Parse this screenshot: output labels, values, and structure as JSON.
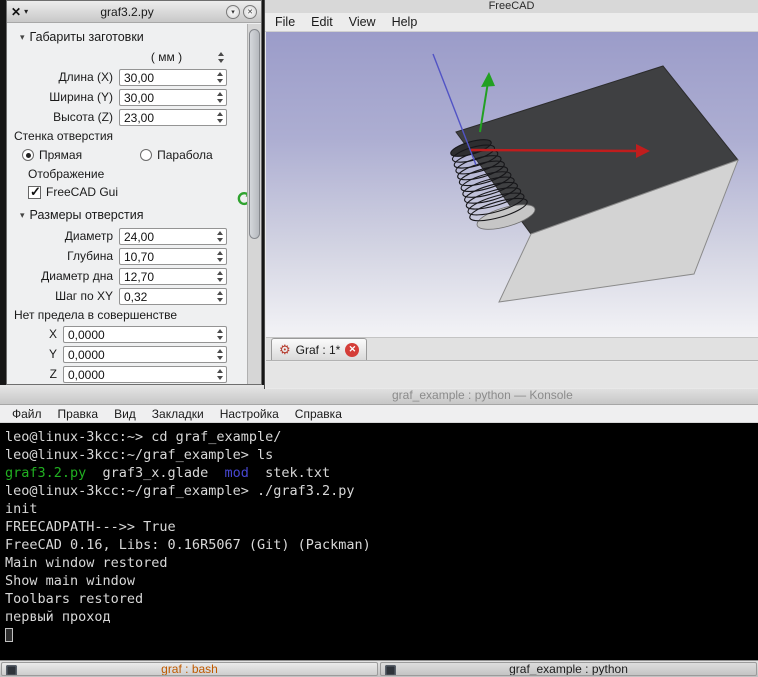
{
  "dialog": {
    "title": "graf3.2.py",
    "sections": {
      "dims_header": "Габариты заготовки",
      "units_label": "( мм )",
      "dims_rows": [
        {
          "name": "length-x",
          "label": "Длина (X)",
          "value": "30,00"
        },
        {
          "name": "width-y",
          "label": "Ширина (Y)",
          "value": "30,00"
        },
        {
          "name": "height-z",
          "label": "Высота (Z)",
          "value": "23,00"
        }
      ],
      "wall_header": "Стенка отверстия",
      "wall_options": [
        {
          "name": "straight",
          "label": "Прямая",
          "selected": true
        },
        {
          "name": "parabola",
          "label": "Парабола",
          "selected": false
        }
      ],
      "display_header": "Отображение",
      "freecad_gui_checkbox": {
        "label": "FreeCAD Gui",
        "checked": true
      },
      "hole_header": "Размеры отверстия",
      "hole_rows": [
        {
          "name": "diameter",
          "label": "Диаметр",
          "value": "24,00"
        },
        {
          "name": "depth",
          "label": "Глубина",
          "value": "10,70"
        },
        {
          "name": "bottom-diameter",
          "label": "Диаметр дна",
          "value": "12,70"
        },
        {
          "name": "xy-step",
          "label": "Шаг по XY",
          "value": "0,32"
        }
      ],
      "perfection_header": "Нет предела в совершенстве",
      "xyz_rows": [
        {
          "name": "offset-x",
          "label": "X",
          "value": "0,0000"
        },
        {
          "name": "offset-y",
          "label": "Y",
          "value": "0,0000"
        },
        {
          "name": "offset-z",
          "label": "Z",
          "value": "0,0000"
        }
      ]
    }
  },
  "freecad": {
    "title": "FreeCAD",
    "menu": [
      {
        "name": "file",
        "label": "File"
      },
      {
        "name": "edit",
        "label": "Edit"
      },
      {
        "name": "view",
        "label": "View"
      },
      {
        "name": "help",
        "label": "Help"
      }
    ],
    "tab": {
      "label": "Graf : 1*"
    }
  },
  "konsole": {
    "title": "graf_example : python — Konsole",
    "menu": [
      {
        "name": "file",
        "label": "Файл"
      },
      {
        "name": "edit",
        "label": "Правка"
      },
      {
        "name": "view",
        "label": "Вид"
      },
      {
        "name": "bookmarks",
        "label": "Закладки"
      },
      {
        "name": "settings",
        "label": "Настройка"
      },
      {
        "name": "help",
        "label": "Справка"
      }
    ],
    "colors": {
      "fg": "#d8d8d8",
      "bg": "#000000",
      "green": "#21b021",
      "blue": "#4747d1"
    },
    "lines": [
      [
        {
          "t": "leo@linux-3kcc:~> cd graf_example/"
        }
      ],
      [
        {
          "t": "leo@linux-3kcc:~/graf_example> ls"
        }
      ],
      [
        {
          "t": "graf3.2.py",
          "c": "green"
        },
        {
          "t": "  graf3_x.glade  "
        },
        {
          "t": "mod",
          "c": "blue"
        },
        {
          "t": "  stek.txt"
        }
      ],
      [
        {
          "t": "leo@linux-3kcc:~/graf_example> ./graf3.2.py"
        }
      ],
      [
        {
          "t": "init"
        }
      ],
      [
        {
          "t": "FREECADPATH--->> True"
        }
      ],
      [
        {
          "t": "FreeCAD 0.16, Libs: 0.16R5067 (Git) (Packman)"
        }
      ],
      [
        {
          "t": "Main window restored"
        }
      ],
      [
        {
          "t": "Show main window"
        }
      ],
      [
        {
          "t": "Toolbars restored"
        }
      ],
      [
        {
          "t": "первый проход"
        }
      ],
      [
        {
          "cursor": true
        }
      ]
    ]
  },
  "taskbar": {
    "items": [
      {
        "name": "graf-bash",
        "label": "graf : bash",
        "color": "#bf5a00",
        "icon": "terminal"
      },
      {
        "name": "graf-example-python",
        "label": "graf_example : python",
        "color": "#1d1d1d",
        "icon": "terminal"
      }
    ]
  }
}
